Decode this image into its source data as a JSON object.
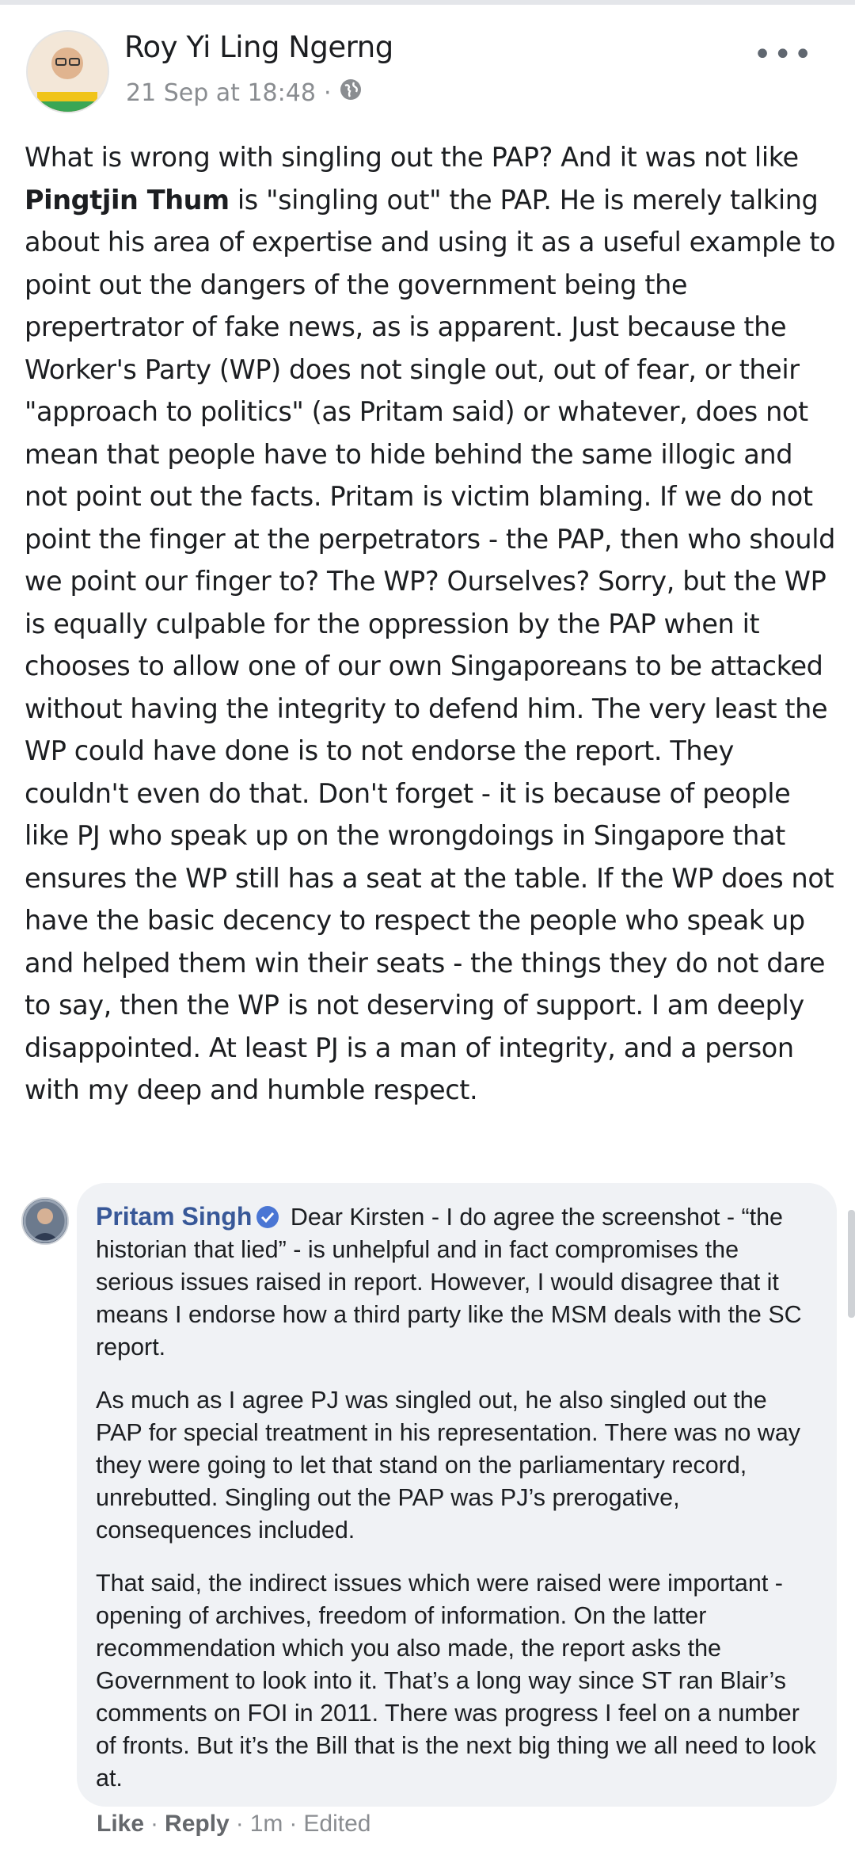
{
  "post": {
    "author": "Roy Yi Ling Ngerng",
    "timestamp": "21 Sep at 18:48",
    "separator": "·",
    "privacy_icon": "globe-icon",
    "more_icon": "•••",
    "text_before_mention": "What is wrong with singling out the PAP? And it was not like ",
    "mention": "Pingtjin Thum",
    "text_after_mention": " is \"singling out\" the PAP. He is merely talking about his area of expertise and using it as a useful example to point out the dangers of the government being the prepertrator of fake news, as is apparent. Just because the Worker's Party (WP) does not single out, out of fear, or their \"approach to politics\" (as Pritam said) or whatever, does not mean that people have to hide behind the same illogic and not point out the facts. Pritam is victim blaming. If we do not point the finger at the perpetrators - the PAP, then who should we point our finger to? The WP? Ourselves? Sorry, but the WP is equally culpable for the oppression by the PAP when it chooses to allow one of our own Singaporeans to be attacked without having the integrity to defend him. The very least the WP could have done is to not endorse the report. They couldn't even do that. Don't forget - it is because of people like PJ who speak up on the wrongdoings in Singapore that ensures the WP still has a seat at the table. If the WP does not have the basic decency to respect the people who speak up and helped them win their seats - the things they do not dare to say, then the WP is not deserving of support. I am deeply disappointed. At least PJ is a man of integrity, and a person with my deep and humble respect."
  },
  "comment": {
    "author": "Pritam Singh",
    "verified_icon": "verified-badge-icon",
    "paragraph1": "Dear Kirsten - I do agree the screenshot - “the historian that lied” - is unhelpful and in fact compromises the serious issues raised in report. However, I would disagree that it means I endorse how a third party like the MSM deals with the SC report.",
    "paragraph2": "As much as I agree PJ was singled out, he also singled out the PAP for special treatment in his representation. There was no way they were going to let that stand on the parliamentary record, unrebutted. Singling out the PAP was PJ’s prerogative, consequences included.",
    "paragraph3": "That said, the indirect issues which were raised were important - opening of archives, freedom of information. On the latter recommendation which you also made, the report asks the Government to look into it. That’s a long way since ST ran Blair’s comments on FOI in 2011. There was progress I feel on a number of fronts. But it’s the Bill that is the next big thing we all need to look at.",
    "actions": {
      "like": "Like",
      "reply": "Reply",
      "time": "1m",
      "edited": "Edited",
      "dot": "·"
    }
  }
}
